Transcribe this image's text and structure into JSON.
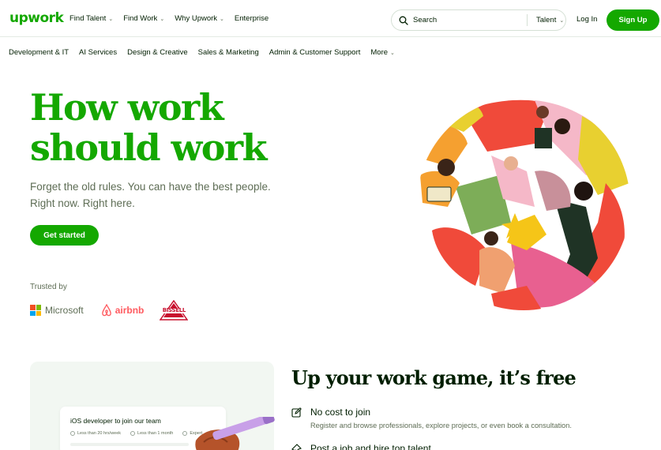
{
  "brand": {
    "logo": "upwork",
    "accent": "#14a800",
    "text": "#001e00",
    "muted": "#5e6d55"
  },
  "nav": {
    "links": [
      {
        "label": "Find Talent",
        "dropdown": true
      },
      {
        "label": "Find Work",
        "dropdown": true
      },
      {
        "label": "Why Upwork",
        "dropdown": true
      },
      {
        "label": "Enterprise",
        "dropdown": false
      }
    ],
    "search": {
      "placeholder": "Search",
      "scope": "Talent"
    },
    "login": "Log In",
    "signup": "Sign Up"
  },
  "categories": [
    "Development & IT",
    "AI Services",
    "Design & Creative",
    "Sales & Marketing",
    "Admin & Customer Support",
    "More"
  ],
  "hero": {
    "title_line1": "How work",
    "title_line2": "should work",
    "subtitle_line1": "Forget the old rules. You can have the best people.",
    "subtitle_line2": "Right now. Right here.",
    "cta": "Get started",
    "trusted_by": "Trusted by",
    "logos": {
      "microsoft": "Microsoft",
      "airbnb": "airbnb",
      "bissell": "BISSELL"
    }
  },
  "promo": {
    "job_title": "iOS developer to join our team",
    "meta": [
      "Less than 20 hrs/week",
      "Less than 1 month",
      "Expert"
    ]
  },
  "section": {
    "title": "Up your work game, it’s free",
    "features": [
      {
        "title": "No cost to join",
        "desc": "Register and browse professionals, explore projects, or even book a consultation.",
        "icon": "edit-icon"
      },
      {
        "title": "Post a job and hire top talent",
        "desc": "",
        "icon": "pin-icon"
      }
    ]
  }
}
